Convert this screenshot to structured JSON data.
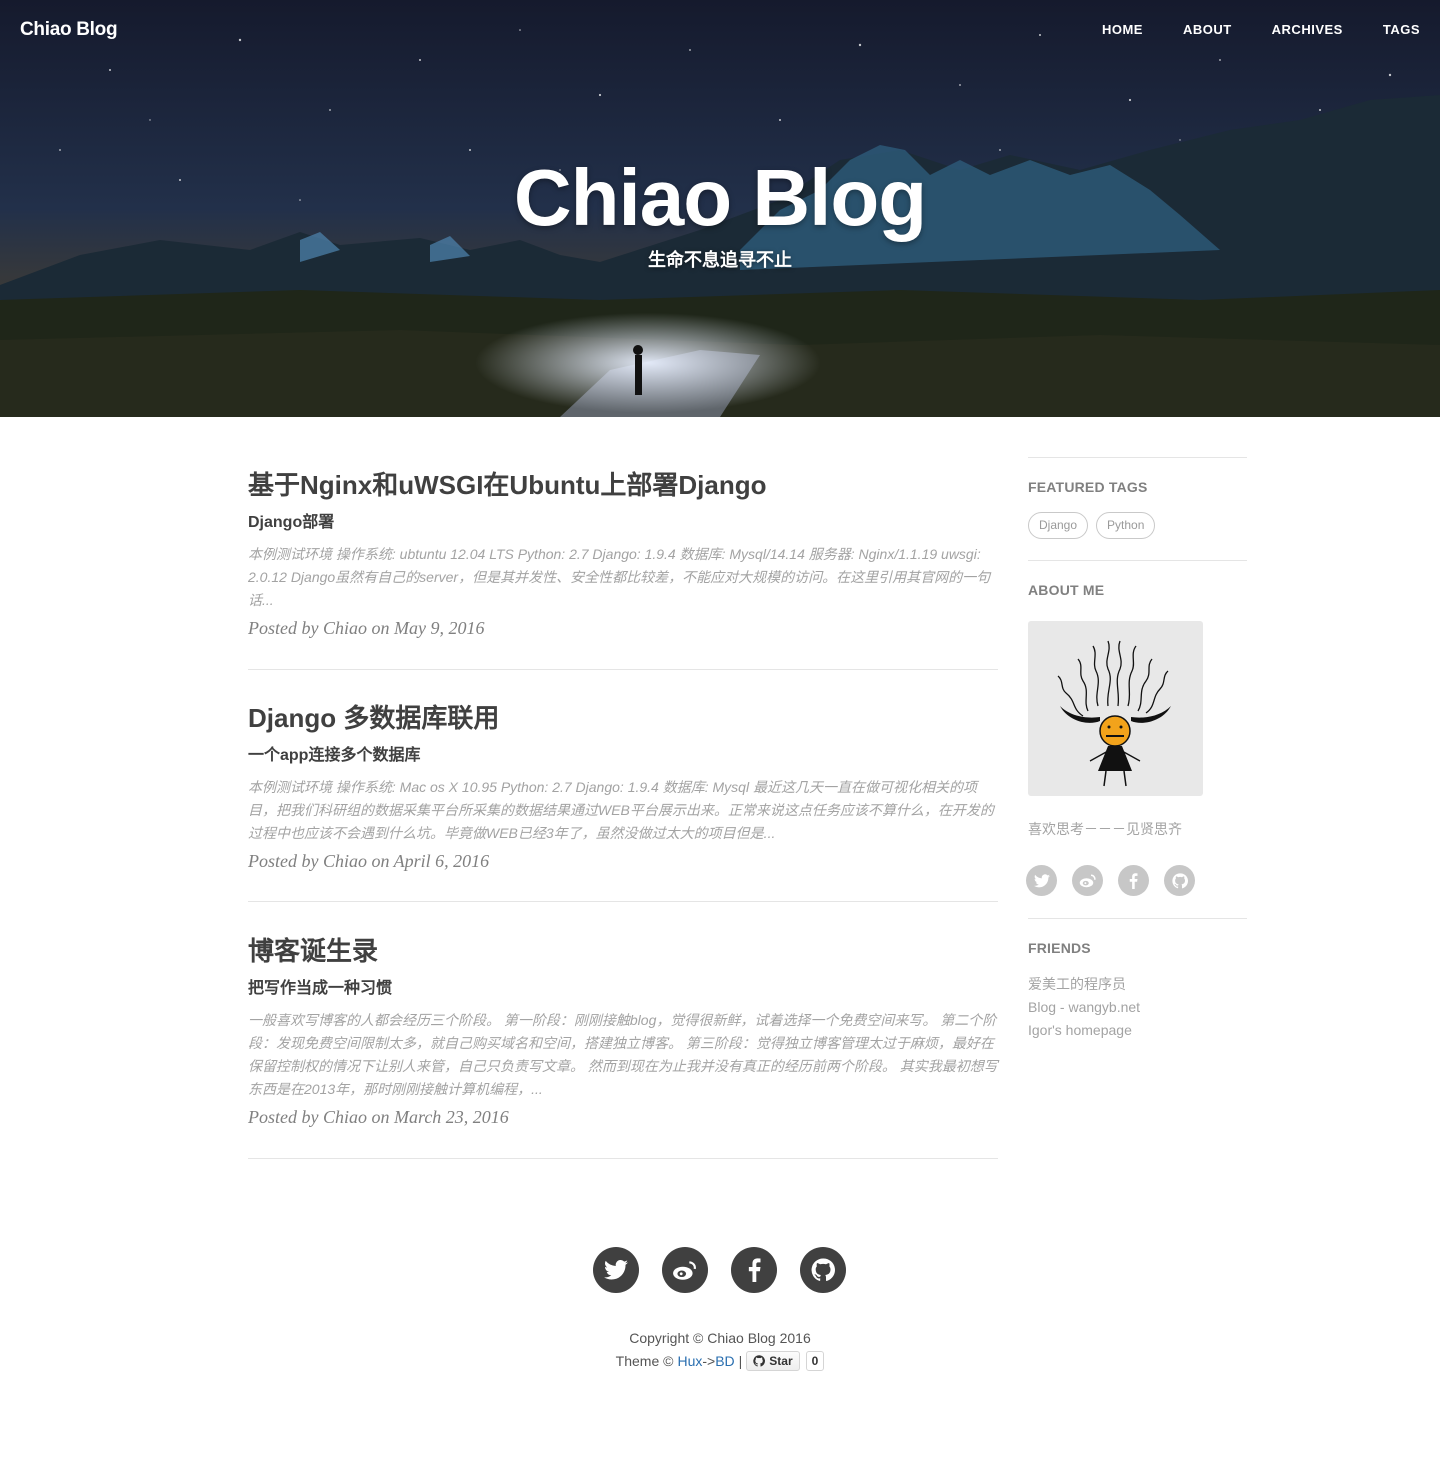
{
  "nav": {
    "brand": "Chiao Blog",
    "links": [
      "HOME",
      "ABOUT",
      "ARCHIVES",
      "TAGS"
    ]
  },
  "hero": {
    "title": "Chiao Blog",
    "subtitle": "生命不息追寻不止"
  },
  "posts": [
    {
      "title": "基于Nginx和uWSGI在Ubuntu上部署Django",
      "subtitle": "Django部署",
      "excerpt": "本例测试环境 操作系统:    ubtuntu 12.04 LTS Python:     2.7 Django:     1.9.4 数据库:     Mysql/14.14 服务器:     Nginx/1.1.19 uwsgi:     2.0.12 Django虽然有自己的server，但是其并发性、安全性都比较差，不能应对大规模的访问。在这里引用其官网的一句话...",
      "meta": "Posted by Chiao on May 9, 2016"
    },
    {
      "title": "Django 多数据库联用",
      "subtitle": "一个app连接多个数据库",
      "excerpt": "本例测试环境 操作系统:    Mac os X 10.95 Python:     2.7 Django:     1.9.4 数据库:     Mysql 最近这几天一直在做可视化相关的项目，把我们科研组的数据采集平台所采集的数据结果通过WEB平台展示出来。正常来说这点任务应该不算什么，在开发的过程中也应该不会遇到什么坑。毕竟做WEB已经3年了，虽然没做过太大的项目但是...",
      "meta": "Posted by Chiao on April 6, 2016"
    },
    {
      "title": "博客诞生录",
      "subtitle": "把写作当成一种习惯",
      "excerpt": "一般喜欢写博客的人都会经历三个阶段。 第一阶段：刚刚接触blog，觉得很新鲜，试着选择一个免费空间来写。 第二个阶段：发现免费空间限制太多，就自己购买域名和空间，搭建独立博客。 第三阶段：觉得独立博客管理太过于麻烦，最好在保留控制权的情况下让别人来管，自己只负责写文章。 然而到现在为止我并没有真正的经历前两个阶段。 其实我最初想写东西是在2013年，那时刚刚接触计算机编程，...",
      "meta": "Posted by Chiao on March 23, 2016"
    }
  ],
  "sidebar": {
    "featured_tags_heading": "FEATURED TAGS",
    "tags": [
      "Django",
      "Python"
    ],
    "about_heading": "ABOUT ME",
    "about_text": "喜欢思考－－－见贤思齐",
    "social_icons": [
      "twitter-icon",
      "weibo-icon",
      "facebook-icon",
      "github-icon"
    ],
    "friends_heading": "FRIENDS",
    "friends": [
      "爱美工的程序员",
      "Blog - wangyb.net",
      "Igor's homepage"
    ]
  },
  "footer": {
    "social_icons": [
      "twitter-icon",
      "weibo-icon",
      "facebook-icon",
      "github-icon"
    ],
    "copyright": "Copyright © Chiao Blog 2016",
    "theme_prefix": "Theme ©",
    "theme_link_1": "Hux",
    "theme_arrow": "->",
    "theme_link_2": "BD",
    "theme_sep": "|",
    "star_label": "Star",
    "star_count": "0"
  },
  "colors": {
    "text": "#404040",
    "muted": "#a3a3a3",
    "link": "#2a6fb0",
    "social_footer": "#404040",
    "social_sidebar": "#c7c7c7"
  }
}
